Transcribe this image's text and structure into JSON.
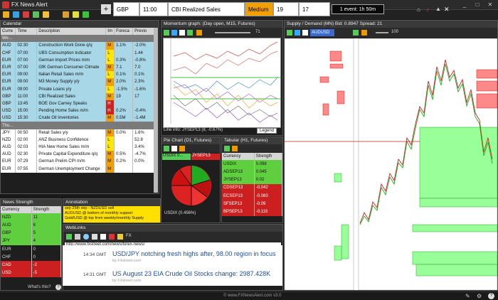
{
  "app": {
    "title": "FX News Alert"
  },
  "event": {
    "pair": "GBP",
    "time": "11:00",
    "name": "CBI Realized Sales",
    "impact": "Medium",
    "actual": "19",
    "previous": "17",
    "countdown": "1 event: 1h 50m"
  },
  "calendar": {
    "title": "Calendar",
    "headers": [
      "Curre",
      "Time",
      "Description",
      "Im",
      "Foreca",
      "Previo"
    ],
    "week_label": "We...",
    "rows": [
      [
        "AUD",
        "02:30",
        "Construction Work Done q/q",
        "M",
        "1.1%",
        "-2.0%"
      ],
      [
        "CHF",
        "07:00",
        "UBS Consumption Indicator",
        "L",
        "",
        "1.44"
      ],
      [
        "EUR",
        "07:00",
        "German Import Prices m/m",
        "L",
        "0.3%",
        "-0.8%"
      ],
      [
        "EUR",
        "07:00",
        "GfK German Consumer Climate",
        "M",
        "7.1",
        "7.0"
      ],
      [
        "EUR",
        "09:00",
        "Italian Retail Sales m/m",
        "L",
        "0.1%",
        "0.1%"
      ],
      [
        "EUR",
        "09:00",
        "M3 Money Supply y/y",
        "M",
        "2.0%",
        "2.3%"
      ],
      [
        "EUR",
        "09:00",
        "Private Loans y/y",
        "L",
        "-1.5%",
        "-1.6%"
      ],
      [
        "GBP",
        "11:00",
        "CBI Realized Sales",
        "M",
        "19",
        "17"
      ],
      [
        "GBP",
        "13:45",
        "BOE Gov Carney Speaks",
        "H",
        "",
        ""
      ],
      [
        "USD",
        "15:00",
        "Pending Home Sales m/m",
        "H",
        "0.2%",
        "-0.4%"
      ],
      [
        "USD",
        "15:30",
        "Crude Oil Inventories",
        "M",
        "0.5M",
        "-1.4M"
      ],
      [
        "Thu...",
        "",
        "",
        "",
        "",
        ""
      ],
      [
        "JPY",
        "00:50",
        "Retail Sales y/y",
        "M",
        "0.0%",
        "1.6%"
      ],
      [
        "NZD",
        "02:00",
        "ANZ Business Confidence",
        "L",
        "",
        "52.8"
      ],
      [
        "AUD",
        "02:03",
        "HIA New Home Sales m/m",
        "L",
        "",
        "3.4%"
      ],
      [
        "AUD",
        "02:30",
        "Private Capital Expenditure q/q",
        "M",
        "0.5%",
        "-4.7%"
      ],
      [
        "EUR",
        "07:29",
        "German Prelim CPI m/m",
        "M",
        "0.2%",
        "0.0%"
      ],
      [
        "EUR",
        "07:55",
        "German Unemployment Change",
        "M",
        "",
        ""
      ]
    ]
  },
  "momentum": {
    "title": "Momentum graph: (Day open, M15, Futures)",
    "info": "Line info: JYSEP13 (8, -0.67%)",
    "legend": "Legend",
    "slider": "71"
  },
  "supply": {
    "title": "Supply / Demand (MN) Bid: 0.8947 Spread: 21",
    "symbol": "AUDUSD",
    "slider": "100"
  },
  "pie": {
    "title": "Pie Chart (D1, Futures)",
    "a": "USDIX 0...",
    "b": "JYSEP13",
    "footer": "USDIX (0.456%)"
  },
  "tabular": {
    "title": "Tabular (H1, Futures)",
    "headers": [
      "Currency",
      "Strength"
    ],
    "rows": [
      [
        "USDIX",
        "0.098",
        "#5fcf3f"
      ],
      [
        "ADSEP13",
        "0.045",
        "#5fcf3f"
      ],
      [
        "JYSEP13",
        "0.02",
        "#5fcf3f"
      ],
      [
        "CDSEP13",
        "-0.042",
        "#cc2020"
      ],
      [
        "ECSEP13",
        "-0.083",
        "#cc2020"
      ],
      [
        "SFSEP13",
        "-0.09",
        "#cc2020"
      ],
      [
        "BPSEP13",
        "-0.116",
        "#cc2020"
      ]
    ]
  },
  "strength": {
    "title": "News Strength",
    "headers": [
      "Currency",
      "Strength"
    ],
    "rows": [
      [
        "NZD",
        "11",
        "#5fcf3f"
      ],
      [
        "AUD",
        "6",
        "#5fcf3f"
      ],
      [
        "GBP",
        "5",
        "#5fcf3f"
      ],
      [
        "JPY",
        "4",
        "#5fcf3f"
      ],
      [
        "EUR",
        "0",
        "#1e1e1e"
      ],
      [
        "CHF",
        "0",
        "#1e1e1e"
      ],
      [
        "CAD",
        "-2",
        "#cc2020"
      ],
      [
        "USD",
        "-5",
        "#cc2020"
      ]
    ],
    "whats_this": "What's this?"
  },
  "annotation": {
    "title": "Annotation",
    "lines": [
      "sep 25th sep - NZDUSD sell",
      "AUDUSD @ bottom of monthly support",
      "Gold/USD @ top from weekly/monthly Supply"
    ]
  },
  "weblinks": {
    "title": "WebLinks",
    "url": "http://www.fxstreet.com/news/forex-news/",
    "items": [
      {
        "time": "14:34 GMT",
        "text": "USD/JPY notching fresh highs after, 98.00 region in focus",
        "src": "by FXstreet.com"
      },
      {
        "time": "14:31 GMT",
        "text": "US August 23 EIA Crude Oil Stocks change: 2987.428K",
        "src": "by FXstreet.com"
      }
    ]
  },
  "footer": "© www.FXNewsAlert.com v3.0",
  "colors": {
    "impact_medium": "#f0a000",
    "impact_low": "#ffe800",
    "impact_high": "#d22020"
  }
}
